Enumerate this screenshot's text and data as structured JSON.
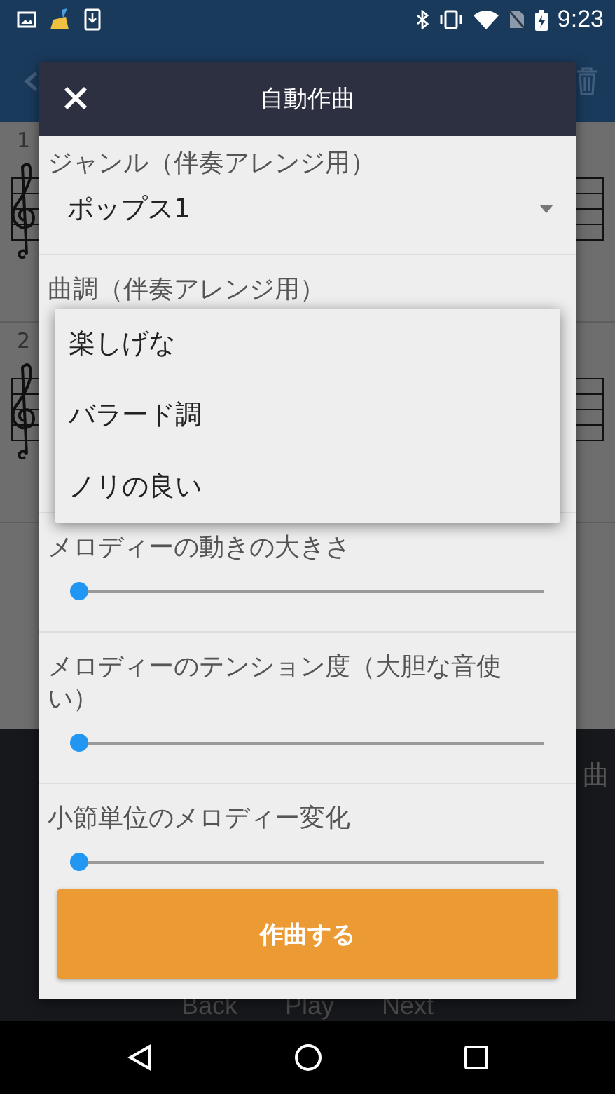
{
  "status_bar": {
    "time": "9:23"
  },
  "score": {
    "measures": [
      {
        "number": "1"
      },
      {
        "number": "2"
      }
    ]
  },
  "bottom_bar": {
    "label": "曲",
    "controls": [
      "Back",
      "Play",
      "Next"
    ]
  },
  "dialog": {
    "title": "自動作曲",
    "sections": [
      {
        "kind": "spinner",
        "label": "ジャンル（伴奏アレンジ用）",
        "value": "ポップス1"
      },
      {
        "kind": "spinner-open",
        "label": "曲調（伴奏アレンジ用）"
      },
      {
        "kind": "slider",
        "label": "メロディーの動きの大きさ",
        "level": 0
      },
      {
        "kind": "slider",
        "label": "メロディーのテンション度（大胆な音使い）",
        "level": 0
      },
      {
        "kind": "slider",
        "label": "小節単位のメロディー変化",
        "level": 0
      }
    ],
    "dropdown": [
      {
        "label": "楽しげな",
        "selected": false
      },
      {
        "label": "バラード調",
        "selected": false
      },
      {
        "label": "ノリの良い",
        "selected": false
      }
    ],
    "button": "作曲する"
  }
}
